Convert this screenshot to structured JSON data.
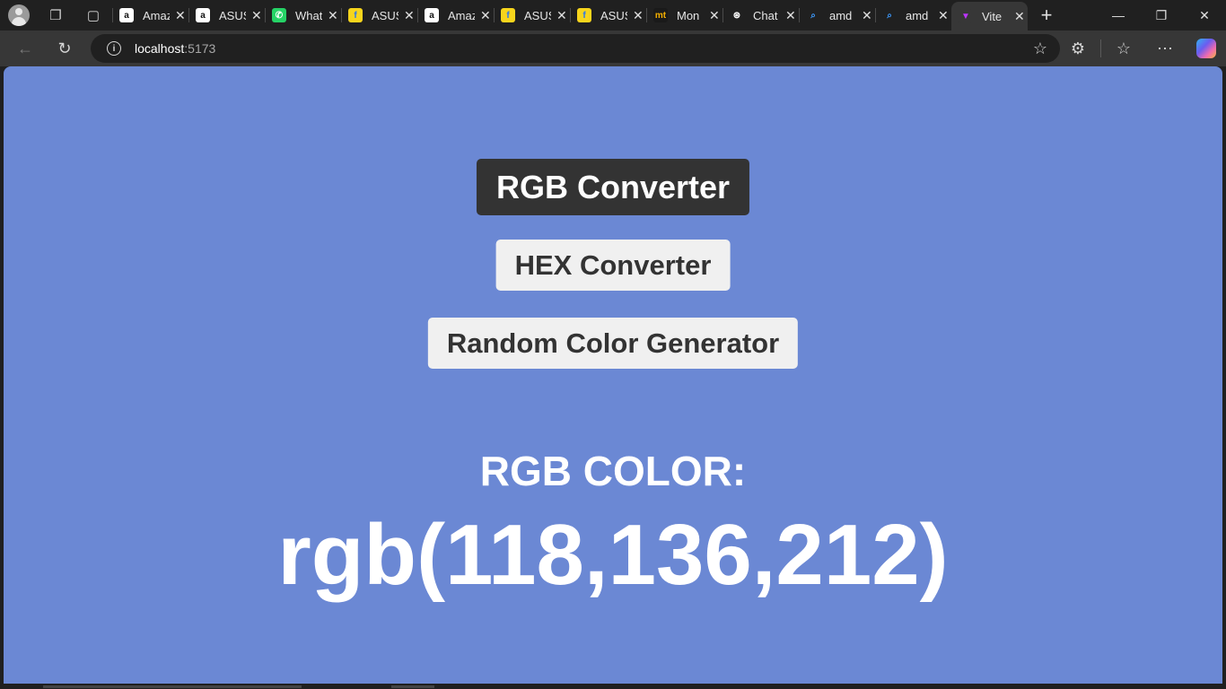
{
  "tabs": [
    {
      "title": "Amazon",
      "icon": "amazon-icon",
      "fav_text": "a",
      "fav_bg": "#ffffff",
      "fav_fg": "#111111"
    },
    {
      "title": "ASUS",
      "icon": "amazon-icon",
      "fav_text": "a",
      "fav_bg": "#ffffff",
      "fav_fg": "#111111"
    },
    {
      "title": "WhatsApp",
      "icon": "whatsapp-icon",
      "fav_text": "✆",
      "fav_bg": "#25d366",
      "fav_fg": "#ffffff"
    },
    {
      "title": "ASUS",
      "icon": "flipkart-icon",
      "fav_text": "f",
      "fav_bg": "#f7d51c",
      "fav_fg": "#2874f0"
    },
    {
      "title": "Amazon",
      "icon": "amazon-icon",
      "fav_text": "a",
      "fav_bg": "#ffffff",
      "fav_fg": "#111111"
    },
    {
      "title": "ASUS",
      "icon": "flipkart-icon",
      "fav_text": "f",
      "fav_bg": "#f7d51c",
      "fav_fg": "#2874f0"
    },
    {
      "title": "ASUS",
      "icon": "flipkart-icon",
      "fav_text": "f",
      "fav_bg": "#f7d51c",
      "fav_fg": "#2874f0"
    },
    {
      "title": "Mon",
      "icon": "mt-icon",
      "fav_text": "mt",
      "fav_bg": "#1a1a1a",
      "fav_fg": "#f5b000"
    },
    {
      "title": "Chat",
      "icon": "chatgpt-icon",
      "fav_text": "⊛",
      "fav_bg": "#202020",
      "fav_fg": "#ffffff"
    },
    {
      "title": "amd",
      "icon": "search-icon",
      "fav_text": "⌕",
      "fav_bg": "#202020",
      "fav_fg": "#3d9bff"
    },
    {
      "title": "amd",
      "icon": "search-icon",
      "fav_text": "⌕",
      "fav_bg": "#202020",
      "fav_fg": "#3d9bff"
    },
    {
      "title": "Vite",
      "icon": "vite-icon",
      "fav_text": "▼",
      "fav_bg": "#373737",
      "fav_fg": "#bd34fe",
      "active": true
    }
  ],
  "address": {
    "host": "localhost",
    "port": ":5173"
  },
  "app": {
    "bg_color": "#6b88d4",
    "buttons": {
      "rgb": "RGB Converter",
      "hex": "HEX Converter",
      "random": "Random Color Generator"
    },
    "label": "RGB COLOR:",
    "value": "rgb(118,136,212)"
  }
}
